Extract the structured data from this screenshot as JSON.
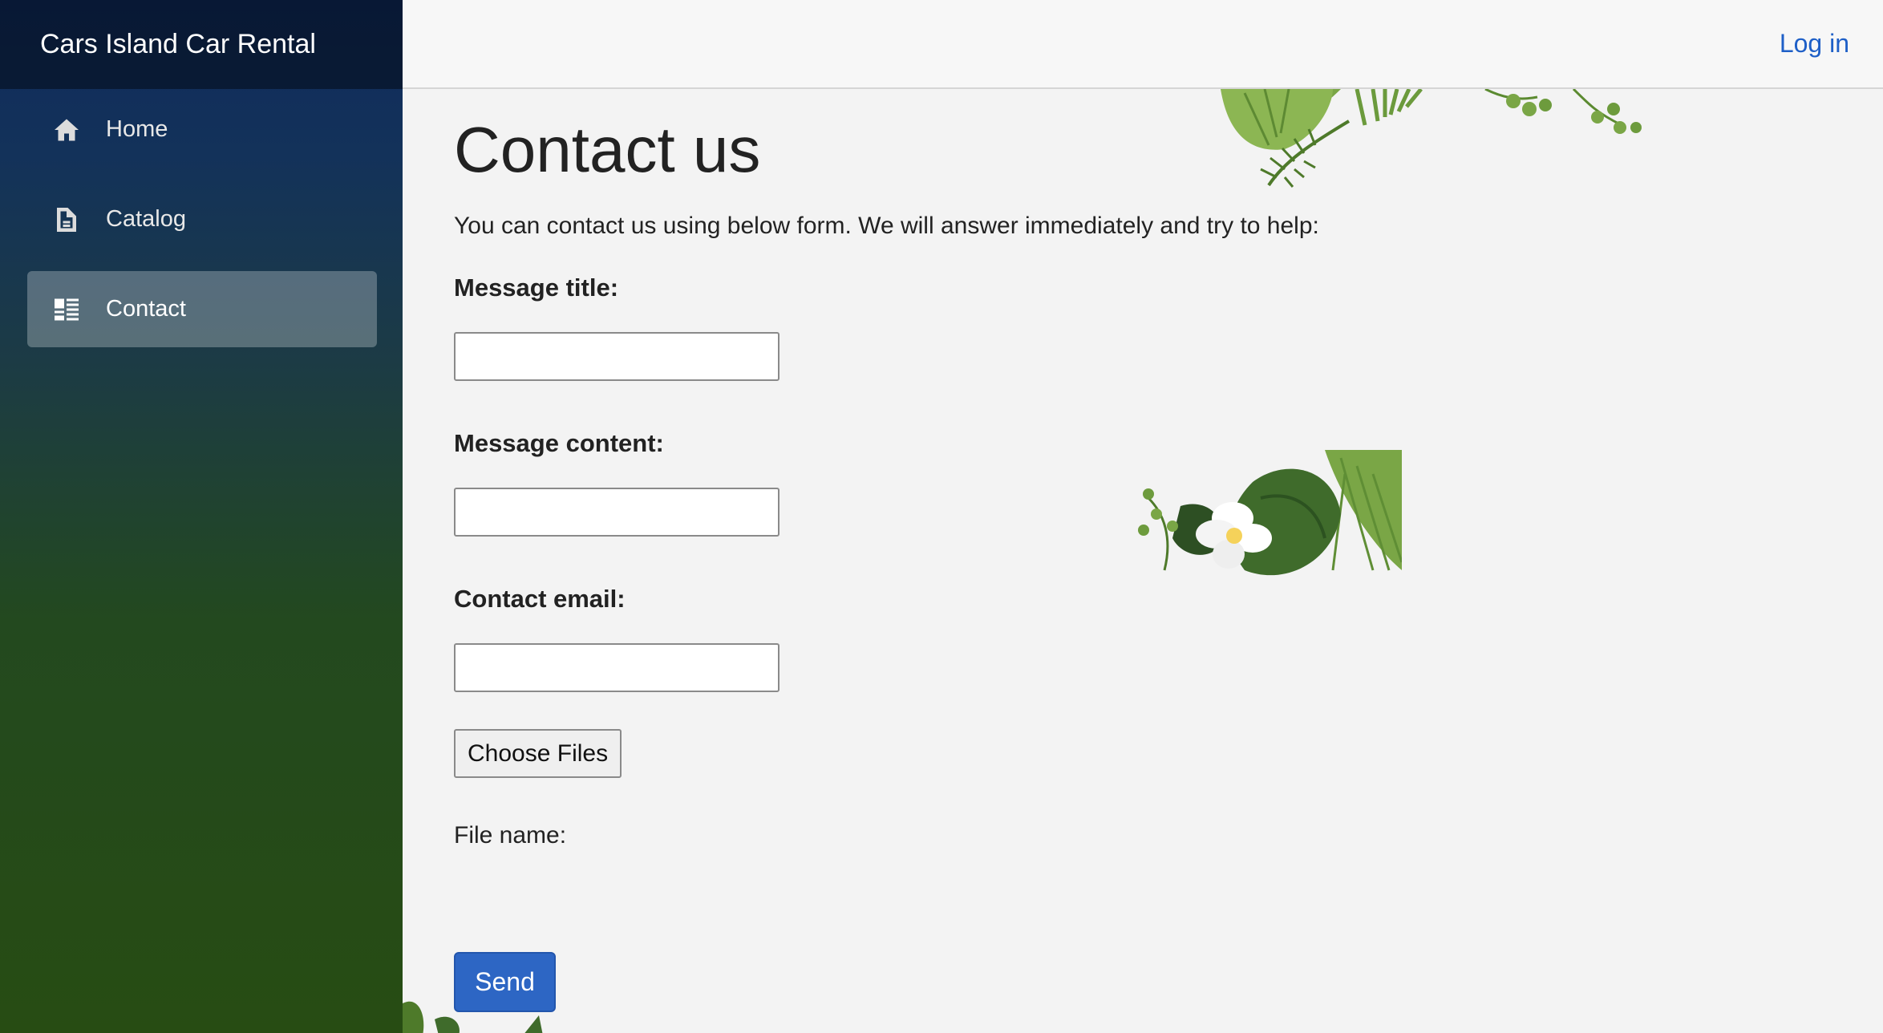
{
  "sidebar": {
    "brand": "Cars Island Car Rental",
    "items": [
      {
        "label": "Home",
        "icon": "home-icon",
        "active": false
      },
      {
        "label": "Catalog",
        "icon": "document-icon",
        "active": false
      },
      {
        "label": "Contact",
        "icon": "list-icon",
        "active": true
      }
    ]
  },
  "topbar": {
    "login_label": "Log in"
  },
  "page": {
    "title": "Contact us",
    "intro": "You can contact us using below form. We will answer immediately and try to help:",
    "form": {
      "title_label": "Message title:",
      "title_value": "",
      "content_label": "Message content:",
      "content_value": "",
      "email_label": "Contact email:",
      "email_value": "",
      "choose_files_label": "Choose Files",
      "file_name_label": "File name:",
      "send_label": "Send"
    }
  },
  "colors": {
    "accent": "#2d66c4",
    "link": "#1e5fc7",
    "sidebar_top": "#0f2a5c",
    "sidebar_bottom": "#274c13"
  }
}
